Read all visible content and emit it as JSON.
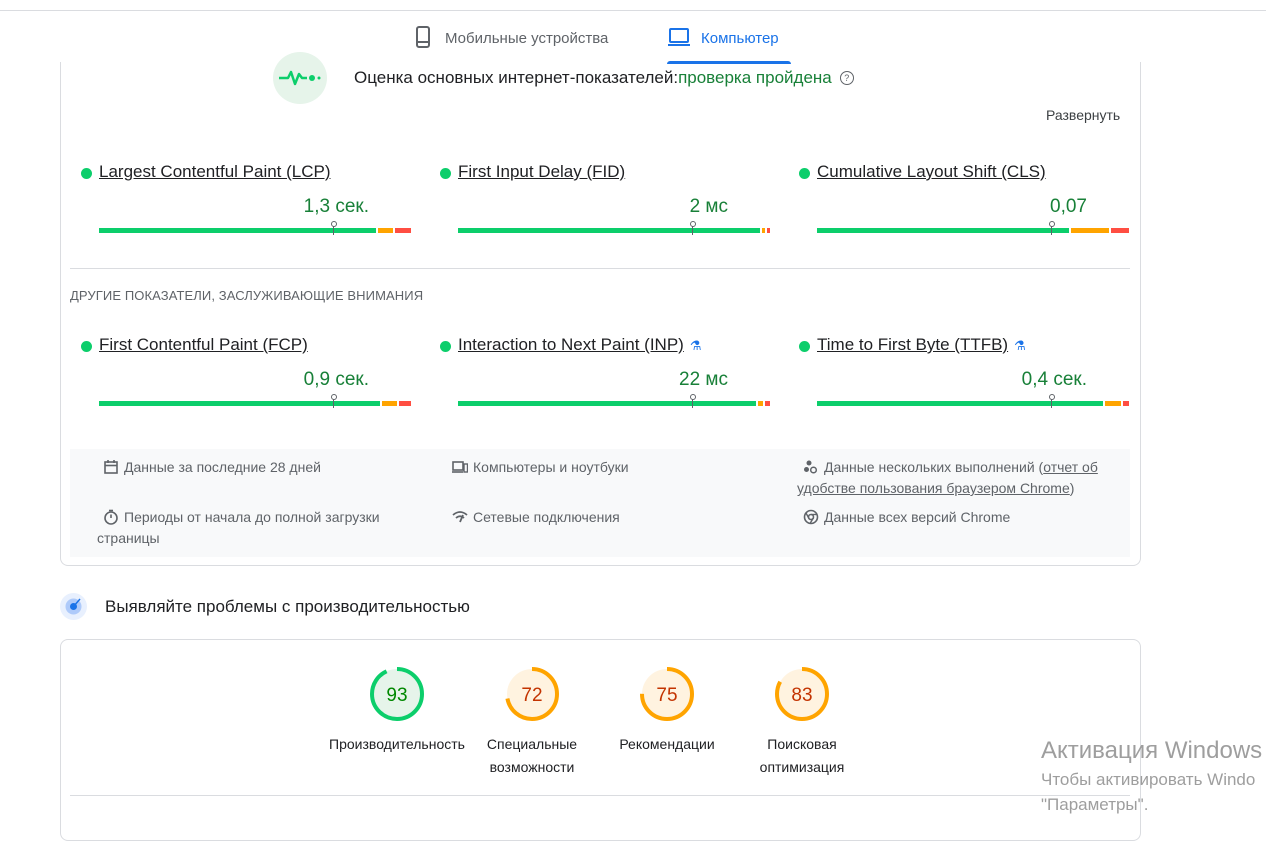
{
  "tabs": [
    {
      "label": "Мобильные устройства",
      "icon": "phone-icon",
      "active": false
    },
    {
      "label": "Компьютер",
      "icon": "laptop-icon",
      "active": true
    }
  ],
  "cwv": {
    "title": "Оценка основных интернет-показателей:",
    "status": "проверка пройдена",
    "expand_label": "Развернуть",
    "metrics": [
      {
        "name": "Largest Contentful Paint (LCP)",
        "value": "1,3 сек."
      },
      {
        "name": "First Input Delay (FID)",
        "value": "2 мс"
      },
      {
        "name": "Cumulative Layout Shift (CLS)",
        "value": "0,07"
      }
    ]
  },
  "other": {
    "title": "ДРУГИЕ ПОКАЗАТЕЛИ, ЗАСЛУЖИВАЮЩИЕ ВНИМАНИЯ",
    "metrics": [
      {
        "name": "First Contentful Paint (FCP)",
        "value": "0,9 сек.",
        "experimental": false
      },
      {
        "name": "Interaction to Next Paint (INP)",
        "value": "22 мс",
        "experimental": true
      },
      {
        "name": "Time to First Byte (TTFB)",
        "value": "0,4 сек.",
        "experimental": true
      }
    ]
  },
  "info": {
    "period": "Данные за последние 28 дней",
    "devices": "Компьютеры и ноутбуки",
    "runs_prefix": "Данные нескольких выполнений (",
    "runs_link": "отчет об удобстве пользования браузером Chrome",
    "runs_suffix": ")",
    "load": "Периоды от начала до полной загрузки страницы",
    "network": "Сетевые подключения",
    "chrome": "Данные всех версий Chrome"
  },
  "diagnose": {
    "title": "Выявляйте проблемы с производительностью"
  },
  "scores": [
    {
      "value": "93",
      "label": "Производительность",
      "color": "#0cce6b",
      "text_color": "#008800",
      "fill": "#e6f4ea"
    },
    {
      "value": "72",
      "label": "Специальные возможности",
      "color": "#ffa400",
      "text_color": "#c33300",
      "fill": "#fff3e0"
    },
    {
      "value": "75",
      "label": "Рекомендации",
      "color": "#ffa400",
      "text_color": "#c33300",
      "fill": "#fff3e0"
    },
    {
      "value": "83",
      "label": "Поисковая оптимизация",
      "color": "#ffa400",
      "text_color": "#c33300",
      "fill": "#fff3e0"
    }
  ],
  "watermark": {
    "line1": "Активация Windows",
    "line2": "Чтобы активировать Windo",
    "line3": "\"Параметры\"."
  }
}
